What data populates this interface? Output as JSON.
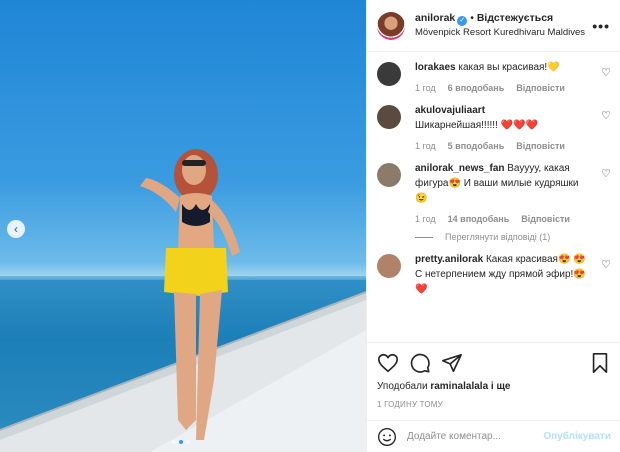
{
  "post": {
    "username": "anilorak",
    "follow_label": "Відстежується",
    "separator": "•",
    "location": "Mövenpick Resort Kuredhivaru Maldives",
    "more_label": "•••"
  },
  "comments": [
    {
      "user": "lorakaes",
      "text": "какая вы красивая!💛",
      "time": "1 год",
      "likes": "6 вподобань",
      "reply": "Відповісти",
      "avatar_color": "#3a3a3a"
    },
    {
      "user": "akulovajuliaart",
      "text": "Шикарнейшая!!!!!! ❤️❤️❤️",
      "time": "1 год",
      "likes": "5 вподобань",
      "reply": "Відповісти",
      "avatar_color": "#5b4a3f"
    },
    {
      "user": "anilorak_news_fan",
      "text": "Вауууу, какая фигура😍 И ваши милые кудряшки😉",
      "time": "1 год",
      "likes": "14 вподобань",
      "reply": "Відповісти",
      "avatar_color": "#8c7a6b"
    },
    {
      "user": "pretty.anilorak",
      "text": "Какая красивая😍 😍 С нетерпением жду прямой эфир!😍❤️",
      "time": "",
      "likes": "",
      "reply": "",
      "avatar_color": "#b0826a"
    }
  ],
  "view_replies": "Переглянути відповіді (1)",
  "actions": {
    "liked_by_prefix": "Уподобали",
    "liked_by_user": "raminalalala",
    "liked_by_suffix": "і ще",
    "timestamp": "1 ГОДИНУ ТОМУ"
  },
  "composer": {
    "placeholder": "Додайте коментар...",
    "publish_label": "Опублікувати"
  },
  "carousel": {
    "prev_glyph": "‹",
    "dots": 3,
    "active_dot": 1
  },
  "colors": {
    "link_blue": "#3897f0",
    "publish_disabled": "#b2dffc",
    "meta_gray": "#8e8e8e"
  }
}
